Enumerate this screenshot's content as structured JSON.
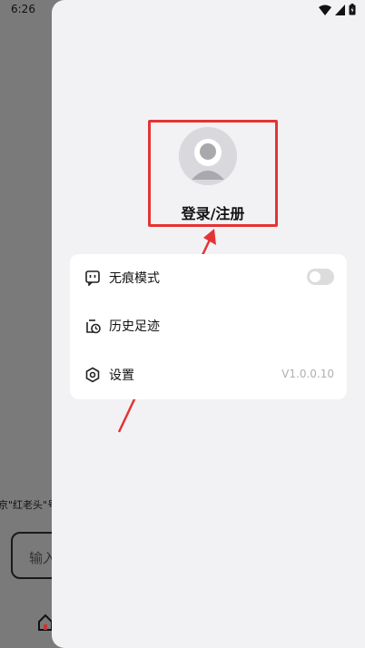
{
  "status_bar": {
    "time": "6:26"
  },
  "background": {
    "snippet": "京\"红老头\"号",
    "input_placeholder": "输入"
  },
  "drawer": {
    "login_label": "登录/注册",
    "menu": {
      "incognito_label": "无痕模式",
      "incognito_enabled": false,
      "history_label": "历史足迹",
      "settings_label": "设置",
      "version": "V1.0.0.10"
    }
  },
  "annotation": {
    "highlight_color": "#e53333"
  }
}
